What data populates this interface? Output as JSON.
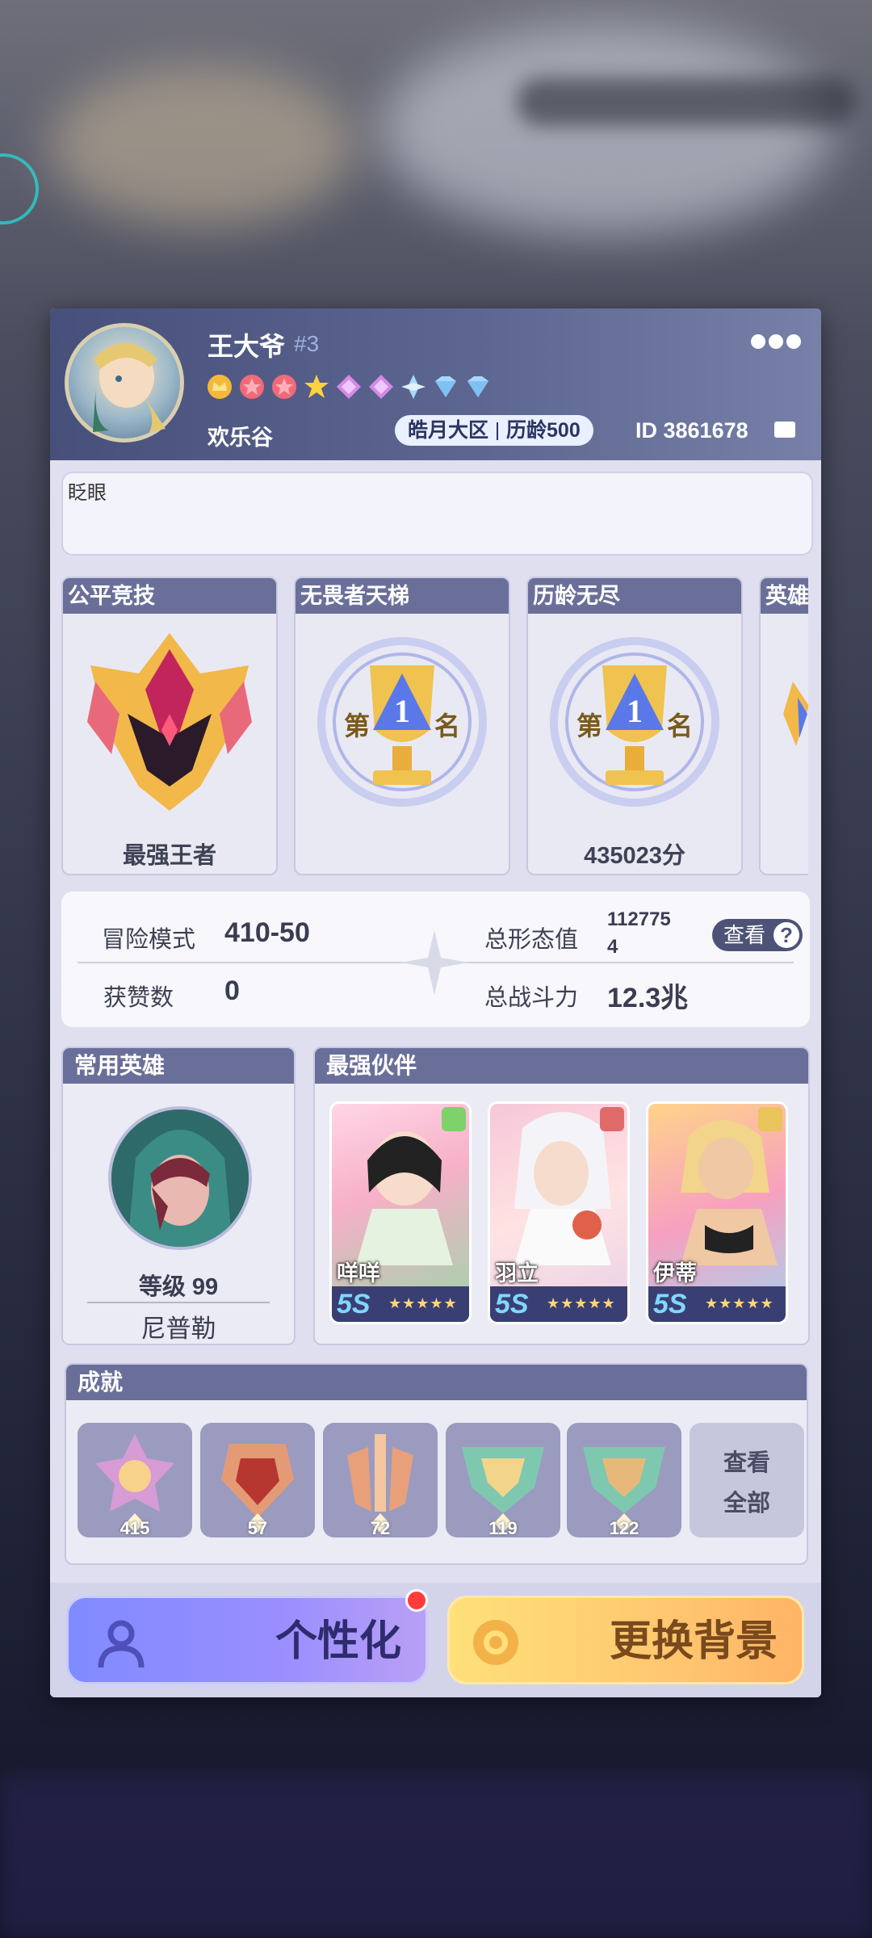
{
  "profile": {
    "name": "王大爷",
    "number": "#3",
    "region": "欢乐谷",
    "server": "皓月大区",
    "age_label": "历龄500",
    "id_label": "ID 3861678",
    "signature": "眨眼",
    "medals": [
      "crown-gold",
      "star-red",
      "star-red",
      "star-gold",
      "diamond-purple",
      "diamond-purple",
      "diamond-blue",
      "diamond-blue",
      "diamond-blue"
    ]
  },
  "ranks": [
    {
      "title": "公平竞技",
      "value": "最强王者",
      "icon": "king-emblem-icon"
    },
    {
      "title": "无畏者天梯",
      "value": "",
      "icon": "trophy-first-icon"
    },
    {
      "title": "历龄无尽",
      "value": "435023分",
      "icon": "trophy-first-icon"
    },
    {
      "title": "英雄",
      "value": "",
      "icon": "partial-emblem-icon"
    }
  ],
  "trophy_text": {
    "left": "第",
    "num": "1",
    "right": "名"
  },
  "stats": {
    "adventure_label": "冒险模式",
    "adventure_value": "410-50",
    "likes_label": "获赞数",
    "likes_value": "0",
    "form_label": "总形态值",
    "form_value_line1": "112775",
    "form_value_line2": "4",
    "power_label": "总战斗力",
    "power_value": "12.3兆",
    "view_label": "查看",
    "view_q": "?"
  },
  "common_hero": {
    "title": "常用英雄",
    "level": "等级 99",
    "name": "尼普勒"
  },
  "partners": {
    "title": "最强伙伴",
    "items": [
      {
        "name": "咩咩",
        "grade": "5S",
        "stars": "★★★★★",
        "color": "#7fd16a"
      },
      {
        "name": "羽立",
        "grade": "5S",
        "stars": "★★★★★",
        "color": "#e06a6a"
      },
      {
        "name": "伊蒂",
        "grade": "5S",
        "stars": "★★★★★",
        "color": "#e8c45a"
      }
    ]
  },
  "achievements": {
    "title": "成就",
    "items": [
      {
        "count": "415",
        "color": "#d79bd6"
      },
      {
        "count": "57",
        "color": "#e59a76"
      },
      {
        "count": "72",
        "color": "#e8a07a"
      },
      {
        "count": "119",
        "color": "#7fc8b0"
      },
      {
        "count": "122",
        "color": "#7fc8b0"
      }
    ],
    "view_all_line1": "查看",
    "view_all_line2": "全部"
  },
  "buttons": {
    "personalize": "个性化",
    "change_bg": "更换背景"
  }
}
